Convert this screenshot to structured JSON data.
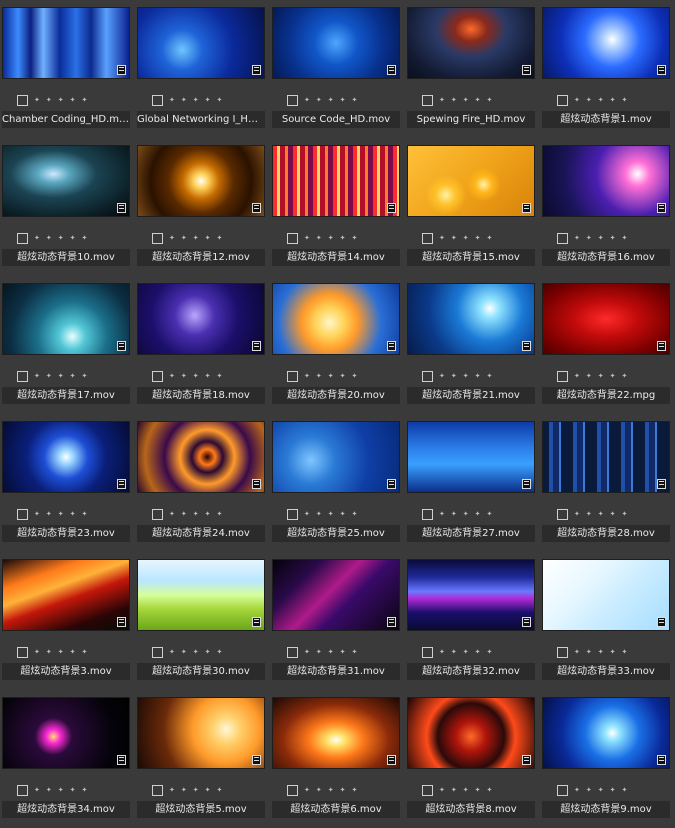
{
  "items": [
    {
      "name": "Chamber Coding_HD.mov",
      "bg": "linear-gradient(90deg,#0a2a9a 0%,#3c8cff 12%,#0b1f80 22%,#6fb0ff 32%,#0a2c9a 45%,#2a70e6 58%,#0d2a8f 70%,#5aa0ff 82%,#0a2290 100%)"
    },
    {
      "name": "Global Networking I_HD.mov",
      "bg": "radial-gradient(circle at 35% 60%,#6fc6ff 0%,#1f63d8 22%,#0b2a9c 55%,#06124a 100%)"
    },
    {
      "name": "Source Code_HD.mov",
      "bg": "radial-gradient(circle at 50% 50%,#4fa6ff 0%,#1157c9 30%,#08318e 65%,#041a55 100%)"
    },
    {
      "name": "Spewing Fire_HD.mov",
      "bg": "radial-gradient(ellipse at 50% 30%,#ff6a2a 0%,#8a2a1c 18%,#2a3a66 40%,#131b33 75%,#0a0f1f 100%)"
    },
    {
      "name": "超炫动态背景1.mov",
      "bg": "radial-gradient(circle at 55% 45%,#ffffff 0%,#b8d6ff 10%,#2b6cff 35%,#0d2fb8 65%,#071a66 100%)"
    },
    {
      "name": "超炫动态背景10.mov",
      "bg": "radial-gradient(ellipse at 40% 40%,#cfe9ff 0%,#5aa6bf 15%,#1b4453 40%,#0c1f26 75%,#05090c 100%)"
    },
    {
      "name": "超炫动态背景12.mov",
      "bg": "radial-gradient(circle at 50% 50%,#ffffff 0%,#ffd35a 10%,#c56b00 25%,#5a2a00 45%,#2a1200 70%,#7a4a18 100%)"
    },
    {
      "name": "超炫动态背景14.mov",
      "bg": "repeating-linear-gradient(90deg,#ff2a2a 0 4px,#ffd56a 4px 7px,#b30f2a 7px 12px,#ff7a2a 12px 15px,#7a0a4a 15px 20px)"
    },
    {
      "name": "超炫动态背景15.mov",
      "bg": "radial-gradient(circle at 30% 70%,#fff3a6 0%,#ffc12a 10%,transparent 20%),radial-gradient(circle at 60% 55%,#fff3a6 0%,#ffb51a 10%,transparent 20%),linear-gradient(135deg,#ffc03a 0%,#f0a41a 50%,#d8820a 100%)"
    },
    {
      "name": "超炫动态背景16.mov",
      "bg": "radial-gradient(circle at 75% 40%,#ffffff 0%,#ff6fd6 12%,#4a1fb0 40%,#1a1458 70%,#0a0a2a 100%)"
    },
    {
      "name": "超炫动态背景17.mov",
      "bg": "radial-gradient(circle at 55% 75%,#e7ffff 0%,#53c7d6 15%,#1b6f8a 40%,#0c2f44 70%,#051520 100%)"
    },
    {
      "name": "超炫动态背景18.mov",
      "bg": "radial-gradient(circle at 45% 45%,#b9a6ff 0%,#4a2fb0 25%,#1b0f6a 55%,#0a062f 100%)"
    },
    {
      "name": "超炫动态背景20.mov",
      "bg": "radial-gradient(circle at 45% 55%,#fff7c8 0%,#ffd45a 18%,#ff9a2a 35%,#2a6fd6 65%,#0f3a9a 100%)"
    },
    {
      "name": "超炫动态背景21.mov",
      "bg": "radial-gradient(circle at 65% 35%,#ffffff 0%,#8fe3ff 10%,#1a7ad6 35%,#0b3a8a 65%,#061c4a 100%)"
    },
    {
      "name": "超炫动态背景22.mpg",
      "bg": "radial-gradient(ellipse at 50% 50%,#ff2a2a 0%,#c30b0b 35%,#7a0000 75%,#4a0000 100%)"
    },
    {
      "name": "超炫动态背景23.mov",
      "bg": "radial-gradient(circle at 50% 50%,#ffffff 0%,#9ad6ff 10%,#1e4fd6 30%,#0a1f7a 55%,#050b33 100%)"
    },
    {
      "name": "超炫动态背景24.mov",
      "bg": "radial-gradient(circle at 55% 50%,#2a0000 0%,#ff7a1a 10%,#2a0a33 20%,#ff9a2a 35%,#3a0a4a 55%,#b8661a 80%,#2a0a2a 100%)"
    },
    {
      "name": "超炫动态背景25.mov",
      "bg": "radial-gradient(circle at 30% 55%,#7fc6ff 0%,#2a7ad6 25%,#0f3fa6 60%,#072a7a 100%)"
    },
    {
      "name": "超炫动态背景27.mov",
      "bg": "linear-gradient(180deg,#0d3aa6 0%,#2a7ae6 35%,#3aa0ff 60%,#0b2f8a 100%)"
    },
    {
      "name": "超炫动态背景28.mov",
      "bg": "repeating-linear-gradient(90deg,#0a1a3a 0 6px,#1f4fa6 6px 10px,#0f2a66 10px 16px,#3a7ad6 16px 18px,#0a1a3a 18px 24px)"
    },
    {
      "name": "超炫动态背景3.mov",
      "bg": "linear-gradient(160deg,#1a0a0a 0%,#ff7a1a 25%,#ffb23a 40%,#c3170b 55%,#2a0505 80%,#0a0a0a 100%)"
    },
    {
      "name": "超炫动态背景30.mov",
      "bg": "linear-gradient(180deg,#e6f6ff 0%,#b9e6ff 30%,#d6ff9a 50%,#a6d63a 70%,#6aa61a 100%)"
    },
    {
      "name": "超炫动态背景31.mov",
      "bg": "linear-gradient(135deg,#05020a 0%,#2a0a4a 25%,#b01a8a 45%,#3a0a6a 60%,#0a0510 100%)"
    },
    {
      "name": "超炫动态背景32.mov",
      "bg": "linear-gradient(180deg,#0a0a3a 0%,#1f2a9a 25%,#6a7aff 45%,#b02ad6 55%,#1a0f6a 75%,#0a0a33 100%)"
    },
    {
      "name": "超炫动态背景33.mov",
      "bg": "linear-gradient(135deg,#ffffff 0%,#e6f7ff 35%,#c9ecff 60%,#a6ddff 100%)"
    },
    {
      "name": "超炫动态背景34.mov",
      "bg": "radial-gradient(circle at 40% 55%,#ffe36a 0%,#ff2ad6 8%,#2a0a3a 22%,#05030a 70%,#000000 100%)"
    },
    {
      "name": "超炫动态背景5.mov",
      "bg": "radial-gradient(circle at 70% 45%,#fff7d6 0%,#ffcf6a 15%,#ff9a2a 35%,#6a2a0a 65%,#1a0a05 100%)"
    },
    {
      "name": "超炫动态背景6.mov",
      "bg": "radial-gradient(ellipse at 50% 60%,#ffffff 0%,#ffe36a 10%,#ff7a1a 30%,#8a2a0a 60%,#1a0a05 100%)"
    },
    {
      "name": "超炫动态背景8.mov",
      "bg": "radial-gradient(circle at 50% 55%,#ff6a2a 0%,#b0150b 20%,#2a0a0a 45%,#ff4a1a 60%,#1a0505 100%)"
    },
    {
      "name": "超炫动态背景9.mov",
      "bg": "radial-gradient(circle at 55% 50%,#ffffff 0%,#8fe3ff 10%,#1a6fe6 35%,#0a2a9a 65%,#041047 100%)"
    }
  ]
}
